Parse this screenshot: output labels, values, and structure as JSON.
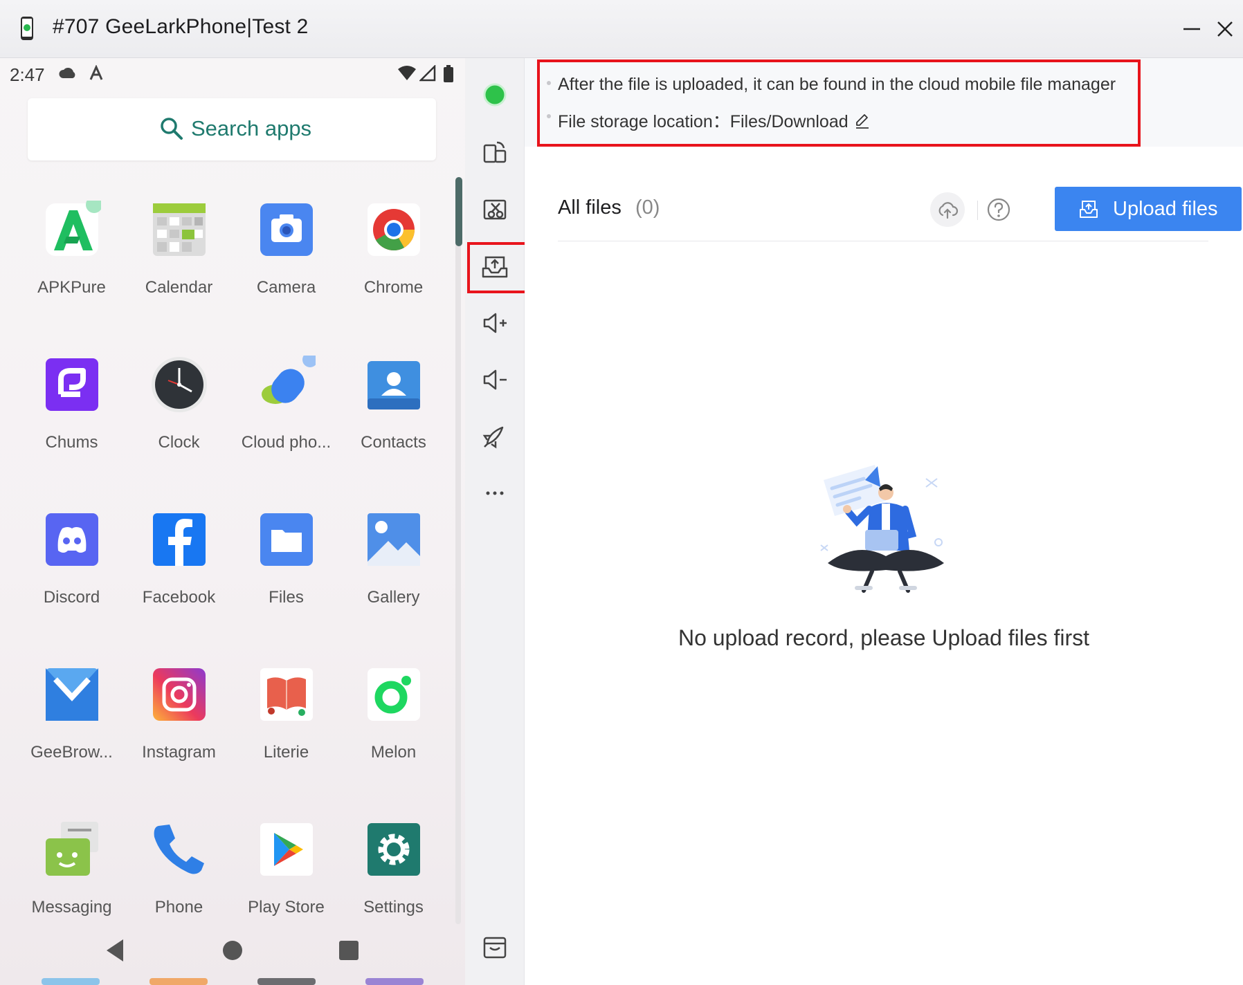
{
  "window": {
    "title": "#707 GeeLarkPhone|Test 2"
  },
  "phone": {
    "status_time": "2:47",
    "search_placeholder": "Search apps",
    "apps": [
      {
        "label": "APKPure",
        "icon": "apkpure-icon"
      },
      {
        "label": "Calendar",
        "icon": "calendar-icon"
      },
      {
        "label": "Camera",
        "icon": "camera-icon"
      },
      {
        "label": "Chrome",
        "icon": "chrome-icon"
      },
      {
        "label": "Chums",
        "icon": "chums-icon"
      },
      {
        "label": "Clock",
        "icon": "clock-icon"
      },
      {
        "label": "Cloud pho...",
        "icon": "cloud-phone-icon"
      },
      {
        "label": "Contacts",
        "icon": "contacts-icon"
      },
      {
        "label": "Discord",
        "icon": "discord-icon"
      },
      {
        "label": "Facebook",
        "icon": "facebook-icon"
      },
      {
        "label": "Files",
        "icon": "files-icon"
      },
      {
        "label": "Gallery",
        "icon": "gallery-icon"
      },
      {
        "label": "GeeBrow...",
        "icon": "geebrowser-icon"
      },
      {
        "label": "Instagram",
        "icon": "instagram-icon"
      },
      {
        "label": "Literie",
        "icon": "literie-icon"
      },
      {
        "label": "Melon",
        "icon": "melon-icon"
      },
      {
        "label": "Messaging",
        "icon": "messaging-icon"
      },
      {
        "label": "Phone",
        "icon": "phone-icon"
      },
      {
        "label": "Play Store",
        "icon": "play-store-icon"
      },
      {
        "label": "Settings",
        "icon": "settings-icon"
      }
    ]
  },
  "toolbar": {
    "tools": [
      "status-dot-icon",
      "rotate-icon",
      "screenshot-icon",
      "upload-file-icon",
      "volume-up-icon",
      "volume-down-icon",
      "rocket-icon",
      "more-icon",
      "shop-icon"
    ]
  },
  "panel": {
    "notice_line1": "After the file is uploaded, it can be found in the cloud mobile file manager",
    "notice_line2_label": "File storage location：",
    "notice_line2_value": "Files/Download",
    "files_title": "All files",
    "files_count": "(0)",
    "upload_button": "Upload files",
    "empty_text": "No upload record, please Upload files first"
  },
  "colors": {
    "accent": "#3b85f0",
    "highlight": "#e8141c",
    "status_green": "#2ec24a"
  }
}
